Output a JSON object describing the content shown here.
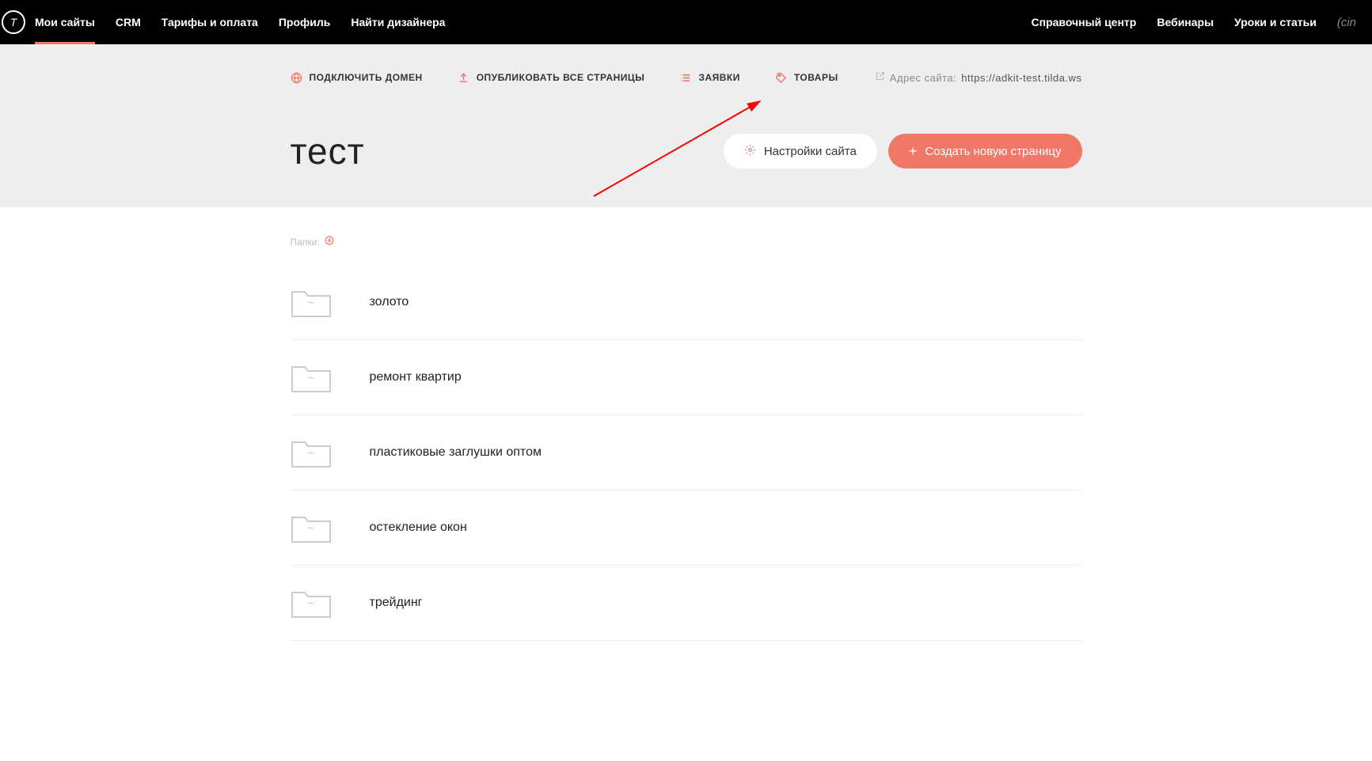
{
  "nav": {
    "left": [
      {
        "id": "my-sites",
        "label": "Мои сайты",
        "active": true
      },
      {
        "id": "crm",
        "label": "CRM",
        "active": false
      },
      {
        "id": "pricing",
        "label": "Тарифы и оплата",
        "active": false
      },
      {
        "id": "profile",
        "label": "Профиль",
        "active": false
      },
      {
        "id": "find-designer",
        "label": "Найти дизайнера",
        "active": false
      }
    ],
    "right": [
      {
        "id": "help",
        "label": "Справочный центр"
      },
      {
        "id": "webinars",
        "label": "Вебинары"
      },
      {
        "id": "lessons",
        "label": "Уроки и статьи"
      }
    ],
    "tail": "(cin"
  },
  "subActions": {
    "domain": "ПОДКЛЮЧИТЬ ДОМЕН",
    "publish": "ОПУБЛИКОВАТЬ ВСЕ СТРАНИЦЫ",
    "leads": "ЗАЯВКИ",
    "products": "ТОВАРЫ"
  },
  "siteAddress": {
    "label": "Адрес сайта:",
    "url": "https://adkit-test.tilda.ws"
  },
  "siteTitle": "тест",
  "buttons": {
    "settings": "Настройки сайта",
    "newPage": "Создать новую страницу"
  },
  "foldersLabel": "Папки:",
  "pages": [
    {
      "name": "золото"
    },
    {
      "name": "ремонт квартир"
    },
    {
      "name": "пластиковые заглушки оптом"
    },
    {
      "name": "остекление окон"
    },
    {
      "name": "трейдинг"
    }
  ],
  "folderGlyph": "~"
}
